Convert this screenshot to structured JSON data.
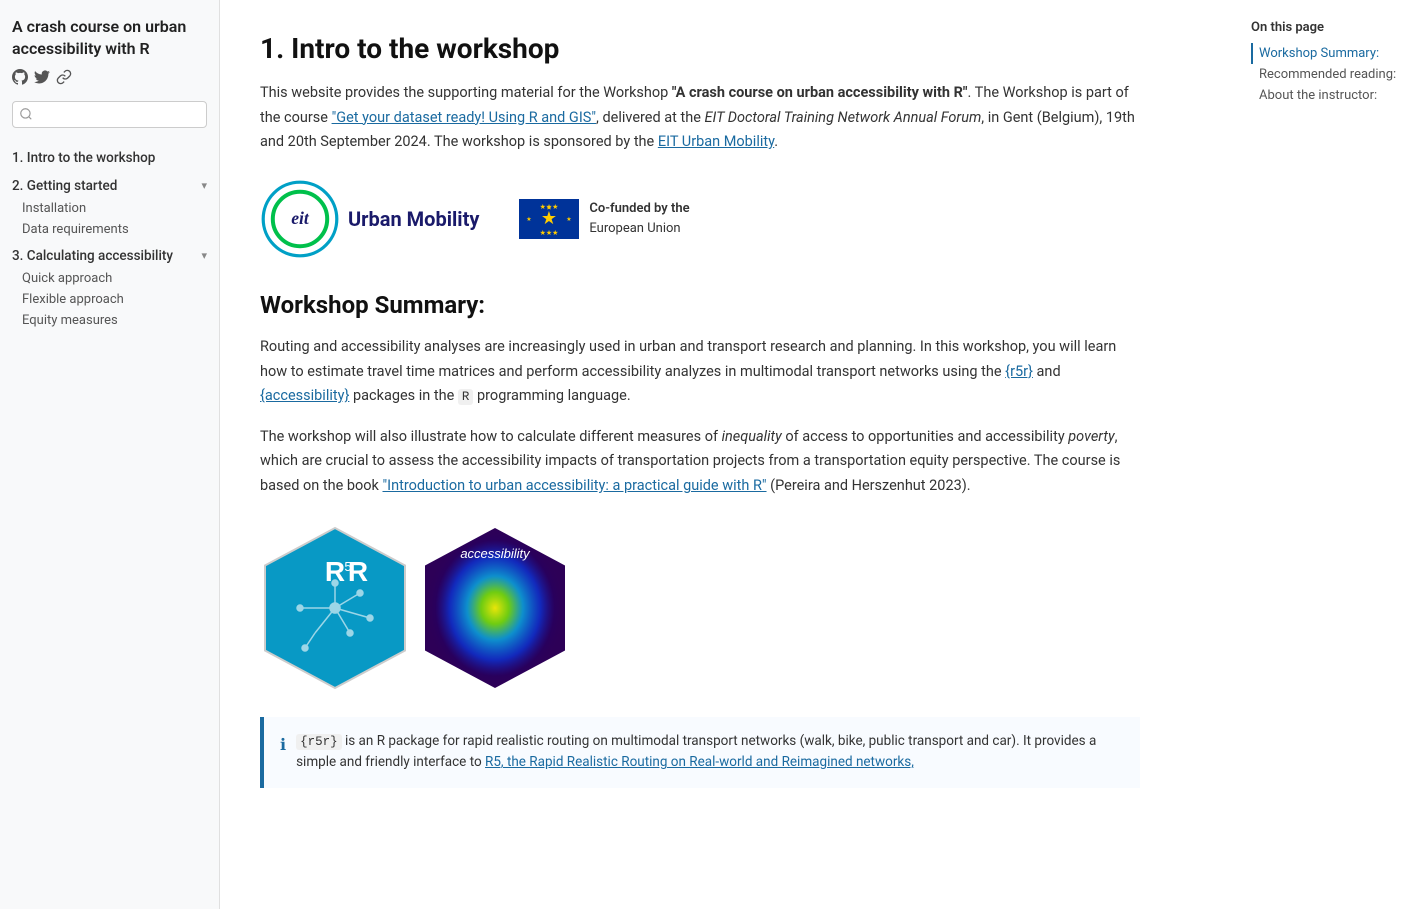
{
  "sidebar": {
    "title": "A crash course on urban accessibility with R",
    "icons": [
      "github",
      "twitter",
      "link"
    ],
    "search_placeholder": "",
    "nav": [
      {
        "label": "1. Intro to the workshop",
        "id": "nav-intro",
        "expandable": false,
        "children": []
      },
      {
        "label": "2. Getting started",
        "id": "nav-getting-started",
        "expandable": true,
        "children": [
          {
            "label": "Installation",
            "id": "nav-installation"
          },
          {
            "label": "Data requirements",
            "id": "nav-data-req"
          }
        ]
      },
      {
        "label": "3. Calculating accessibility",
        "id": "nav-calc-access",
        "expandable": true,
        "children": [
          {
            "label": "Quick approach",
            "id": "nav-quick"
          },
          {
            "label": "Flexible approach",
            "id": "nav-flexible"
          },
          {
            "label": "Equity measures",
            "id": "nav-equity"
          }
        ]
      }
    ]
  },
  "toc": {
    "title": "On this page",
    "items": [
      {
        "label": "Workshop Summary:",
        "active": true
      },
      {
        "label": "Recommended reading:",
        "active": false
      },
      {
        "label": "About the instructor:",
        "active": false
      }
    ]
  },
  "main": {
    "heading": "1. Intro to the workshop",
    "intro_p1_part1": "This website provides the supporting material for the Workshop ",
    "intro_bold": "\"A crash course on urban accessibility with R\"",
    "intro_p1_part2": ". The Workshop is part of the course ",
    "intro_link1": "\"Get your dataset ready! Using R and GIS\"",
    "intro_p1_part3": ", delivered at the ",
    "intro_italic1": "EIT Doctoral Training Network Annual Forum",
    "intro_p1_part4": ", in Gent (Belgium), 19th and 20th September 2024. The workshop is sponsored by the ",
    "intro_link2": "EIT Urban Mobility",
    "intro_p1_end": ".",
    "workshop_summary_heading": "Workshop Summary:",
    "summary_p1": "Routing and accessibility analyses are increasingly used in urban and transport research and planning. In this workshop, you will learn how to estimate travel time matrices and perform accessibility analyzes in multimodal transport networks using the ",
    "pkg1": "{r5r}",
    "summary_p1_mid": " and ",
    "pkg2": "{accessibility}",
    "summary_p1_end": " packages in the ",
    "r_code": "R",
    "summary_p1_last": " programming language.",
    "summary_p2_part1": "The workshop will also illustrate how to calculate different measures of ",
    "summary_italic1": "inequality",
    "summary_p2_part2": " of access to opportunities and accessibility ",
    "summary_italic2": "poverty",
    "summary_p2_part3": ", which are crucial to assess the accessibility impacts of transportation projects from a transportation equity perspective. The course is based on the book ",
    "summary_link": "\"Introduction to urban accessibility: a practical guide with R\"",
    "summary_p2_part4": " (Pereira and Herszenhut 2023).",
    "info_pkg": "{r5r}",
    "info_text1": " is an R package for rapid realistic routing on multimodal transport networks (walk, bike, public transport and car). It provides a simple and friendly interface to ",
    "info_link": "R5, the Rapid Realistic Routing on Real-world and Reimagined networks,"
  }
}
